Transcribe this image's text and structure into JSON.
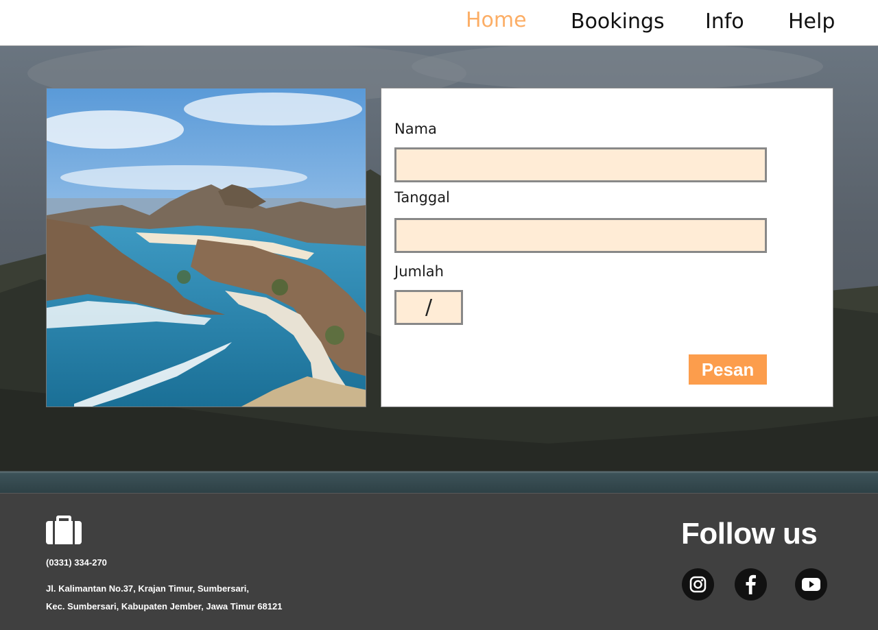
{
  "nav": {
    "items": [
      {
        "label": "Home",
        "active": true
      },
      {
        "label": "Bookings",
        "active": false
      },
      {
        "label": "Info",
        "active": false
      },
      {
        "label": "Help",
        "active": false
      }
    ]
  },
  "form": {
    "name_label": "Nama",
    "name_value": "",
    "date_label": "Tanggal",
    "date_value": "",
    "qty_label": "Jumlah",
    "qty_value": "/",
    "submit_label": "Pesan"
  },
  "footer": {
    "logo_icon": "suitcase-icon",
    "phone": "(0331) 334-270",
    "address_line1": "Jl. Kalimantan No.37, Krajan Timur, Sumbersari,",
    "address_line2": "Kec. Sumbersari, Kabupaten Jember, Jawa Timur 68121",
    "follow_title": "Follow us",
    "social": [
      "instagram-icon",
      "facebook-icon",
      "youtube-icon"
    ]
  },
  "colors": {
    "accent": "#fc9d4c",
    "nav_active": "#fcae66",
    "input_bg": "#ffecd6",
    "footer_bg": "#404040"
  }
}
